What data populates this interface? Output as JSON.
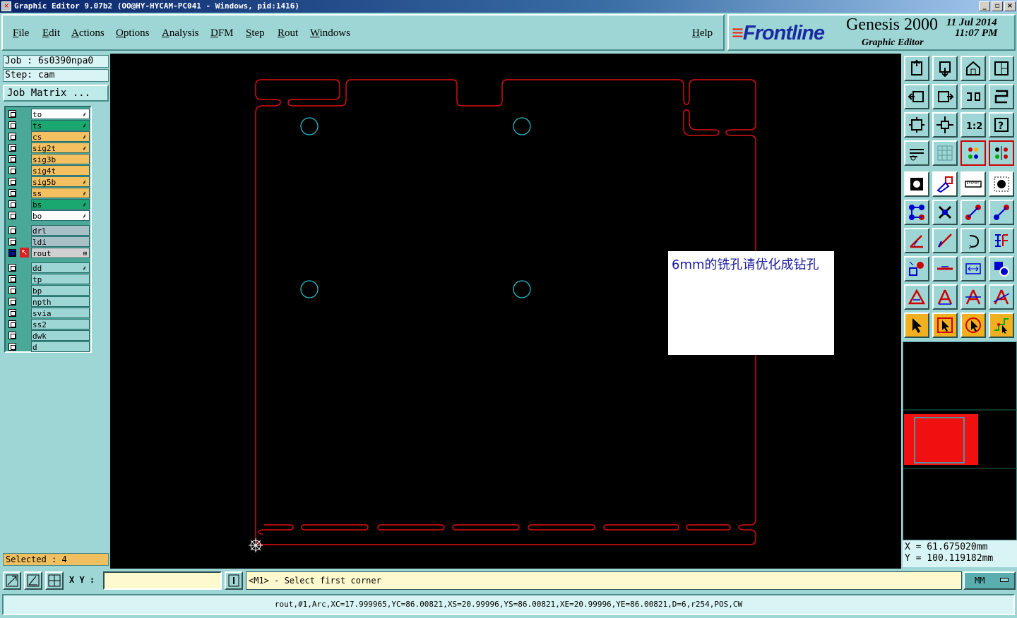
{
  "window": {
    "title": "Graphic Editor 9.07b2 (OO@HY-HYCAM-PC041 - Windows, pid:1416)"
  },
  "menu": [
    "File",
    "Edit",
    "Actions",
    "Options",
    "Analysis",
    "DFM",
    "Step",
    "Rout",
    "Windows"
  ],
  "help_label": "Help",
  "logo": {
    "brand": "Frontline",
    "product": "Genesis 2000",
    "subtitle": "Graphic Editor",
    "date": "11 Jul 2014",
    "time": "11:07 PM"
  },
  "job": {
    "job_line": "Job : 6s0390npa0",
    "step_line": "Step: cam",
    "matrix_button": "Job Matrix ..."
  },
  "layers": [
    {
      "name": "to",
      "color": "#ffffff",
      "flag": "⸙"
    },
    {
      "name": "ts",
      "color": "#1aa870",
      "flag": "⸙"
    },
    {
      "name": "cs",
      "color": "#f5c060",
      "flag": "⸙"
    },
    {
      "name": "sig2t",
      "color": "#f5c060",
      "flag": "⸙"
    },
    {
      "name": "sig3b",
      "color": "#f5c060",
      "flag": ""
    },
    {
      "name": "sig4t",
      "color": "#f5c060",
      "flag": ""
    },
    {
      "name": "sig5b",
      "color": "#f5c060",
      "flag": "⸙"
    },
    {
      "name": "ss",
      "color": "#f5c060",
      "flag": "⸙"
    },
    {
      "name": "bs",
      "color": "#1aa870",
      "flag": "⸙"
    },
    {
      "name": "bo",
      "color": "#ffffff",
      "flag": "⸙"
    },
    {
      "name": "drl",
      "color": "#a8c0c8",
      "flag": ""
    },
    {
      "name": "ldi",
      "color": "#a8c0c8",
      "flag": ""
    },
    {
      "name": "rout",
      "color": "#d0d0d0",
      "flag": "⊞",
      "active": true
    },
    {
      "name": "dd",
      "color": "#9ed6d6",
      "flag": "⸙"
    },
    {
      "name": "tp",
      "color": "#9ed6d6",
      "flag": ""
    },
    {
      "name": "bp",
      "color": "#9ed6d6",
      "flag": ""
    },
    {
      "name": "npth",
      "color": "#9ed6d6",
      "flag": ""
    },
    {
      "name": "svia",
      "color": "#9ed6d6",
      "flag": ""
    },
    {
      "name": "ss2",
      "color": "#9ed6d6",
      "flag": ""
    },
    {
      "name": "dwk",
      "color": "#9ed6d6",
      "flag": ""
    },
    {
      "name": "d",
      "color": "#9ed6d6",
      "flag": ""
    }
  ],
  "selected_text": "Selected : 4",
  "annotation_note": "6mm的铣孔请优化成钻孔",
  "coords": {
    "x_line": "X = 61.675020mm",
    "y_line": "Y = 100.119182mm"
  },
  "command": {
    "xy_label": "X Y :",
    "xy_value": "",
    "prompt": "<M1> - Select first corner",
    "units": "MM"
  },
  "status_line": "rout,#1,Arc,XC=17.999965,YC=86.00821,XS=20.99996,YS=86.00821,XE=20.99996,YE=86.00821,D=6,r254,POS,CW",
  "tool_icons": [
    "home-icon",
    "zoom-home-icon",
    "house-icon",
    "window-split-icon",
    "pan-left-icon",
    "pan-right-icon",
    "redraw-icon",
    "snap-icon",
    "fit-screen-icon",
    "zoom-fit-icon",
    "scale-1-2-icon",
    "help-query-icon",
    "tools-icon",
    "grid-icon",
    "layer-colors-icon",
    "layer-compare-icon",
    "feature-icon",
    "polygon-icon",
    "ruler-icon",
    "pad-icon",
    "nodes-icon",
    "cross-icon",
    "connect-icon",
    "connect-alt-icon",
    "angle-icon",
    "line-icon",
    "arc-icon",
    "text-icon",
    "pad-red-icon",
    "dash-icon",
    "measure-icon",
    "shapes-icon",
    "triangle-icon",
    "triangle-a-icon",
    "triangle-a2-icon",
    "triangle-a3-icon",
    "pointer-icon",
    "pointer-box-icon",
    "pointer-circle-icon",
    "pointer-path-icon"
  ]
}
